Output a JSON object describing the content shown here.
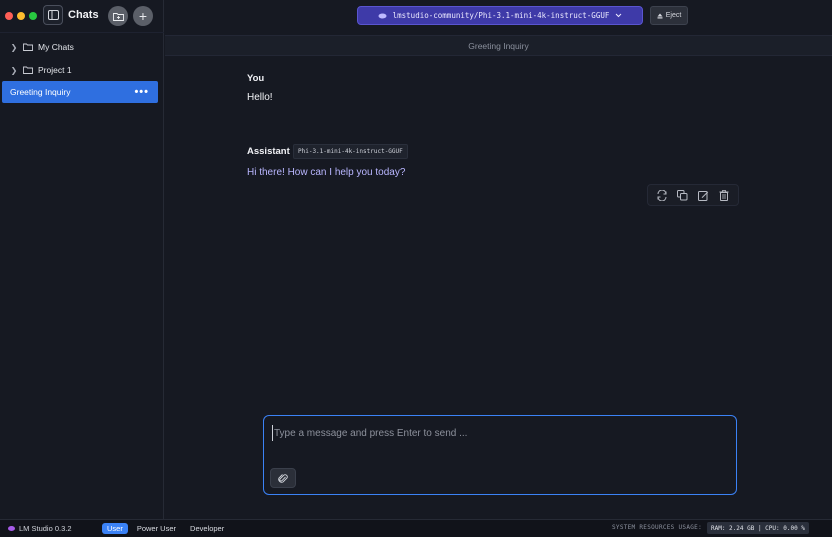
{
  "sidebar": {
    "title": "Chats",
    "new_folder_icon": "folder-plus-icon",
    "new_chat_symbol": "+",
    "items": [
      {
        "label": "My Chats",
        "icon": "folder-icon"
      },
      {
        "label": "Project 1",
        "icon": "folder-icon"
      }
    ],
    "active_chat": {
      "label": "Greeting Inquiry",
      "menu": "•••"
    }
  },
  "topbar": {
    "model_name": "lmstudio-community/Phi-3.1-mini-4k-instruct-GGUF",
    "eject_label": "Eject"
  },
  "chat": {
    "title": "Greeting Inquiry",
    "messages": [
      {
        "role": "You",
        "text": "Hello!"
      },
      {
        "role": "Assistant",
        "model": "Phi-3.1-mini-4k-instruct-GGUF",
        "text": "Hi there! How can I help you today?"
      }
    ],
    "actions": [
      "regenerate-icon",
      "copy-icon",
      "edit-icon",
      "trash-icon"
    ]
  },
  "composer": {
    "placeholder": "Type a message and press Enter to send ..."
  },
  "statusbar": {
    "app_version": "LM Studio 0.3.2",
    "modes": [
      "User",
      "Power User",
      "Developer"
    ],
    "active_mode": "User",
    "resources_label": "SYSTEM RESOURCES USAGE:",
    "resources_value": "RAM: 2.24 GB | CPU: 0.00 %"
  },
  "colors": {
    "accent": "#2f6fe0",
    "model_selector": "#3e3aa8",
    "assistant_text": "#b9b6ff",
    "composer_border": "#3b82f6"
  }
}
